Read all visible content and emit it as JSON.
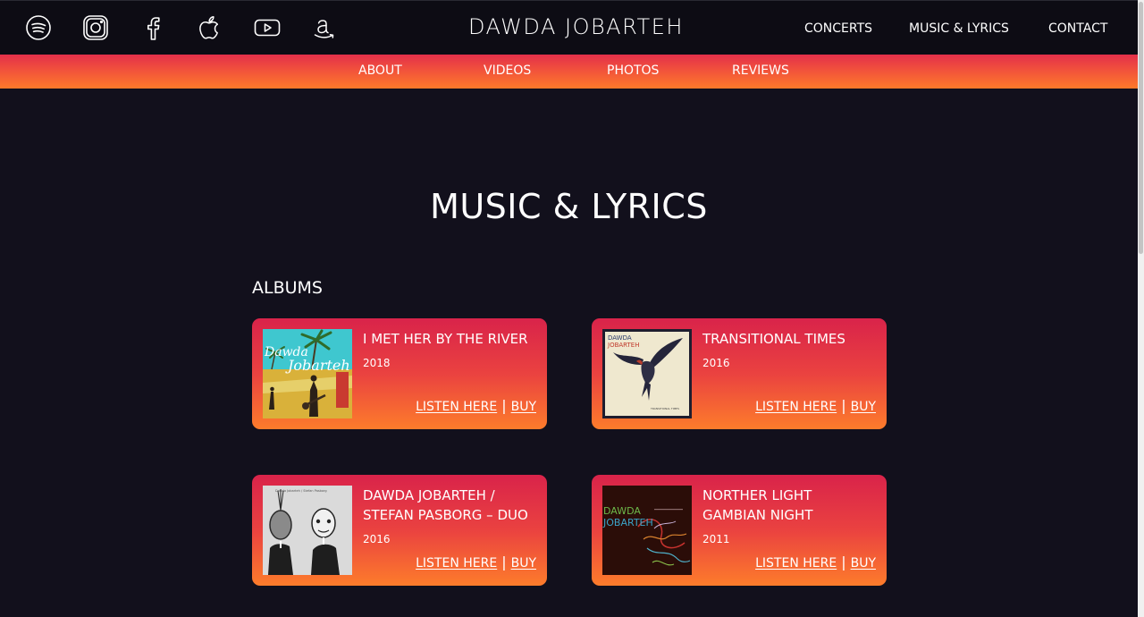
{
  "header": {
    "logo_text": "DAWDA JOBARTEH",
    "social_icons": [
      "spotify-icon",
      "instagram-icon",
      "facebook-icon",
      "apple-music-icon",
      "youtube-icon",
      "amazon-icon"
    ],
    "nav": {
      "concerts": "CONCERTS",
      "music_lyrics": "MUSIC & LYRICS",
      "contact": "CONTACT"
    }
  },
  "subnav": {
    "about": "ABOUT",
    "videos": "VIDEOS",
    "photos": "PHOTOS",
    "reviews": "REVIEWS"
  },
  "main": {
    "page_title": "MUSIC & LYRICS",
    "section_title": "ALBUMS",
    "albums": [
      {
        "title": "I MET HER BY THE RIVER",
        "year": "2018",
        "listen_label": "LISTEN HERE",
        "buy_label": "BUY",
        "cover_text": [
          "Dawda",
          "Jobarteh"
        ]
      },
      {
        "title": "TRANSITIONAL TIMES",
        "year": "2016",
        "listen_label": "LISTEN HERE",
        "buy_label": "BUY",
        "cover_text": [
          "DAWDA",
          "JOBARTEH",
          "TRANSITIONAL TIMES"
        ]
      },
      {
        "title": "DAWDA JOBARTEH /\nSTEFAN PASBORG – DUO",
        "year": "2016",
        "listen_label": "LISTEN HERE",
        "buy_label": "BUY",
        "cover_text": [
          "Dawda Jobarteh / Stefan Pasborg"
        ]
      },
      {
        "title": "NORTHER LIGHT\nGAMBIAN NIGHT",
        "year": "2011",
        "listen_label": "LISTEN HERE",
        "buy_label": "BUY",
        "cover_text": [
          "DAWDA",
          "JOBARTEH"
        ]
      }
    ]
  },
  "colors": {
    "page_background": "#12101c",
    "topbar_background": "#0d0c14",
    "gradient_top": "#d9234a",
    "gradient_bottom": "#fd7c2b",
    "text": "#ffffff"
  }
}
